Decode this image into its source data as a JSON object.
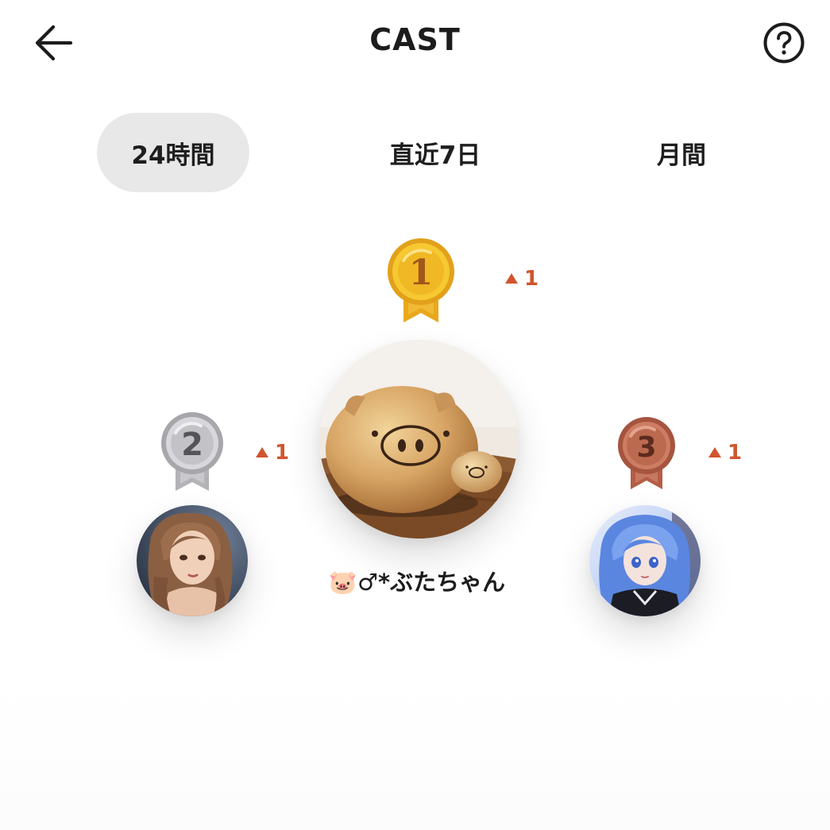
{
  "header": {
    "title": "CAST",
    "back_icon": "arrow-left-icon",
    "help_icon": "question-circle-icon"
  },
  "tabs": [
    {
      "label": "24時間",
      "active": true
    },
    {
      "label": "直近7日",
      "active": false
    },
    {
      "label": "月間",
      "active": false
    }
  ],
  "ranking": {
    "first": {
      "rank": "1",
      "change": "1",
      "name": "🐷♂*ぶたちゃん",
      "medal_color": "#e7a91f"
    },
    "second": {
      "rank": "2",
      "change": "1",
      "medal_color": "#b9b9bd"
    },
    "third": {
      "rank": "3",
      "change": "1",
      "medal_color": "#b8664f"
    },
    "change_color": "#d1552e"
  }
}
